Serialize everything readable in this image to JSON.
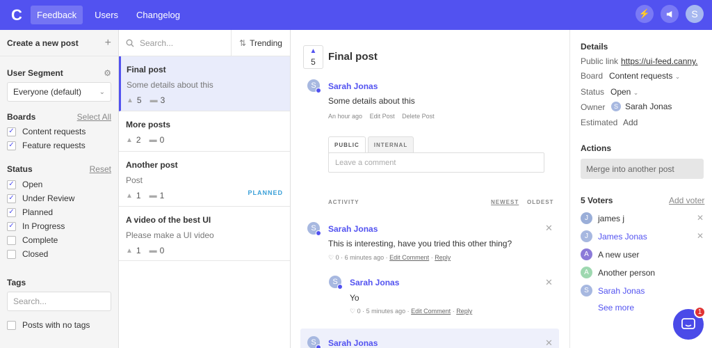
{
  "nav": {
    "logo": "C",
    "tabs": [
      "Feedback",
      "Users",
      "Changelog"
    ],
    "bolt": "⚡",
    "avatar": "S"
  },
  "filters": {
    "create_label": "Create a new post",
    "segment_label": "User Segment",
    "segment_value": "Everyone (default)",
    "boards_label": "Boards",
    "boards_select_all": "Select All",
    "boards": [
      {
        "label": "Content requests",
        "checked": true
      },
      {
        "label": "Feature requests",
        "checked": true
      }
    ],
    "status_label": "Status",
    "status_reset": "Reset",
    "statuses": [
      {
        "label": "Open",
        "checked": true
      },
      {
        "label": "Under Review",
        "checked": true
      },
      {
        "label": "Planned",
        "checked": true
      },
      {
        "label": "In Progress",
        "checked": true
      },
      {
        "label": "Complete",
        "checked": false
      },
      {
        "label": "Closed",
        "checked": false
      }
    ],
    "tags_label": "Tags",
    "tags_placeholder": "Search...",
    "no_tags": "Posts with no tags"
  },
  "list": {
    "search_placeholder": "Search...",
    "sort": "Trending",
    "posts": [
      {
        "title": "Final post",
        "desc": "Some details about this",
        "votes": "5",
        "comments": "3",
        "badge": ""
      },
      {
        "title": "More posts",
        "desc": "",
        "votes": "2",
        "comments": "0",
        "badge": ""
      },
      {
        "title": "Another post",
        "desc": "Post",
        "votes": "1",
        "comments": "1",
        "badge": "PLANNED"
      },
      {
        "title": "A video of the best UI",
        "desc": "Please make a UI video",
        "votes": "1",
        "comments": "0",
        "badge": ""
      }
    ]
  },
  "post": {
    "votes": "5",
    "title": "Final post",
    "author": "Sarah Jonas",
    "author_initial": "S",
    "body": "Some details about this",
    "time": "An hour ago",
    "edit": "Edit Post",
    "delete": "Delete Post",
    "tab_public": "PUBLIC",
    "tab_internal": "INTERNAL",
    "comment_placeholder": "Leave a comment",
    "activity": "ACTIVITY",
    "newest": "NEWEST",
    "oldest": "OLDEST",
    "c1": {
      "author": "Sarah Jonas",
      "text": "This is interesting, have you tried this other thing?",
      "likes": "0",
      "time": "6 minutes ago",
      "edit": "Edit Comment",
      "reply": "Reply"
    },
    "c2": {
      "author": "Sarah Jonas",
      "text": "Yo",
      "likes": "0",
      "time": "5 minutes ago",
      "edit": "Edit Comment",
      "reply": "Reply"
    },
    "c3": {
      "author": "Sarah Jonas"
    }
  },
  "details": {
    "heading": "Details",
    "public_link_label": "Public link",
    "public_link": "https://ui-feed.canny.",
    "board_label": "Board",
    "board": "Content requests",
    "status_label": "Status",
    "status": "Open",
    "owner_label": "Owner",
    "owner": "Sarah Jonas",
    "estimated_label": "Estimated",
    "estimated": "Add",
    "actions": "Actions",
    "merge": "Merge into another post",
    "voters_label": "5 Voters",
    "add_voter": "Add voter",
    "voters": [
      {
        "initial": "J",
        "name": "james j"
      },
      {
        "initial": "J",
        "name": "James Jonas"
      },
      {
        "initial": "A",
        "name": "A new user"
      },
      {
        "initial": "A",
        "name": "Another person"
      },
      {
        "initial": "S",
        "name": "Sarah Jonas"
      }
    ],
    "see_more": "See more"
  },
  "chat_badge": "1",
  "colors": {
    "brand": "#5252f0",
    "planned": "#3aa0d8",
    "badge": "#e03333"
  }
}
